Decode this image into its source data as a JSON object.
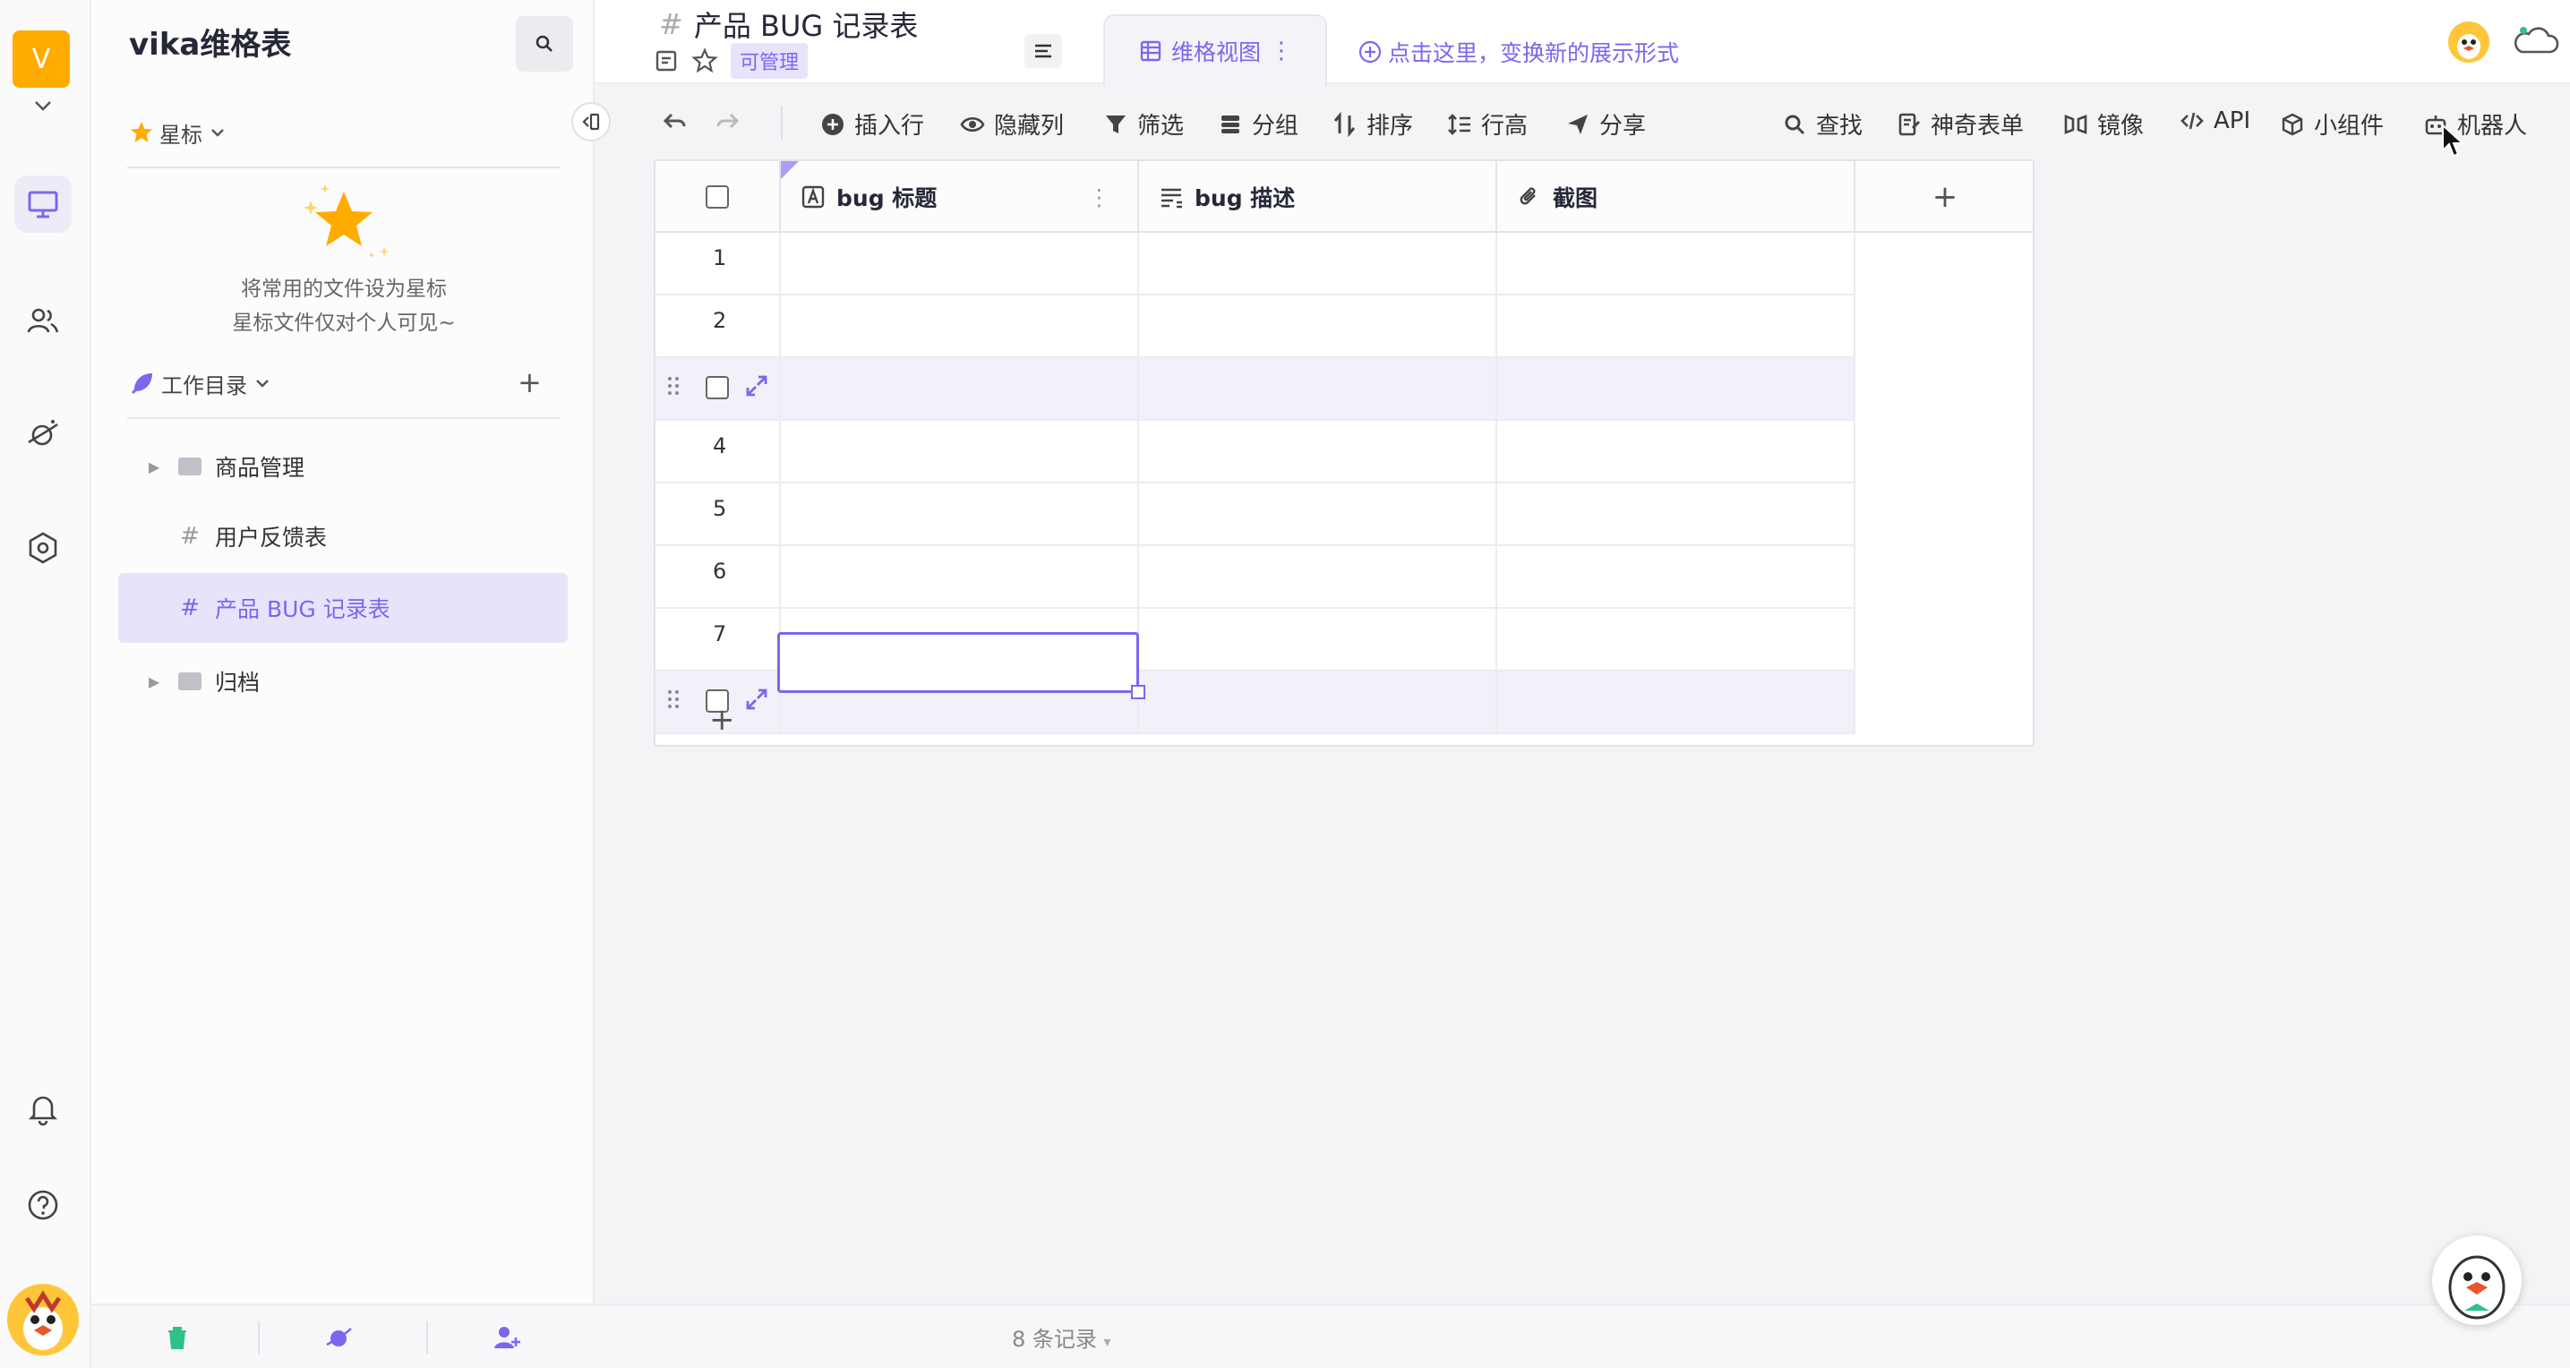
{
  "rail": {
    "workspace_initial": "V",
    "nav": [
      {
        "name": "workbench",
        "icon": "monitor-icon",
        "active": true
      },
      {
        "name": "members",
        "icon": "people-icon",
        "active": false
      },
      {
        "name": "explore",
        "icon": "planet-icon",
        "active": false
      },
      {
        "name": "settings",
        "icon": "hexagon-gear-icon",
        "active": false
      }
    ],
    "bottom": [
      {
        "name": "notifications",
        "icon": "bell-icon"
      },
      {
        "name": "help",
        "icon": "question-icon"
      }
    ]
  },
  "sidebar": {
    "title": "vika维格表",
    "starred_label": "星标",
    "starred_empty_line1": "将常用的文件设为星标",
    "starred_empty_line2": "星标文件仅对个人可见~",
    "workdir_label": "工作目录",
    "items": [
      {
        "label": "商品管理",
        "type": "folder"
      },
      {
        "label": "用户反馈表",
        "type": "sheet"
      },
      {
        "label": "产品 BUG 记录表",
        "type": "sheet",
        "selected": true
      },
      {
        "label": "归档",
        "type": "folder"
      }
    ]
  },
  "header": {
    "title": "产品 BUG 记录表",
    "permission_badge": "可管理",
    "view_tab": "维格视图",
    "add_view_hint": "点击这里，变换新的展示形式"
  },
  "toolbar": {
    "insert_row": "插入行",
    "hide_columns": "隐藏列",
    "filter": "筛选",
    "group": "分组",
    "sort": "排序",
    "row_height": "行高",
    "share": "分享",
    "find": "查找",
    "form": "神奇表单",
    "mirror": "镜像",
    "api": "API",
    "widgets": "小组件",
    "robot": "机器人"
  },
  "grid": {
    "columns": [
      {
        "label": "bug 标题",
        "icon": "text-field-icon"
      },
      {
        "label": "bug 描述",
        "icon": "long-text-icon"
      },
      {
        "label": "截图",
        "icon": "attachment-icon"
      }
    ],
    "rows": [
      "1",
      "2",
      "",
      "4",
      "5",
      "6",
      "7",
      ""
    ],
    "add_row": "+",
    "add_column": "+"
  },
  "footer": {
    "records": "8 条记录"
  },
  "colors": {
    "accent": "#7b67ee",
    "workspace": "#ffab00"
  }
}
